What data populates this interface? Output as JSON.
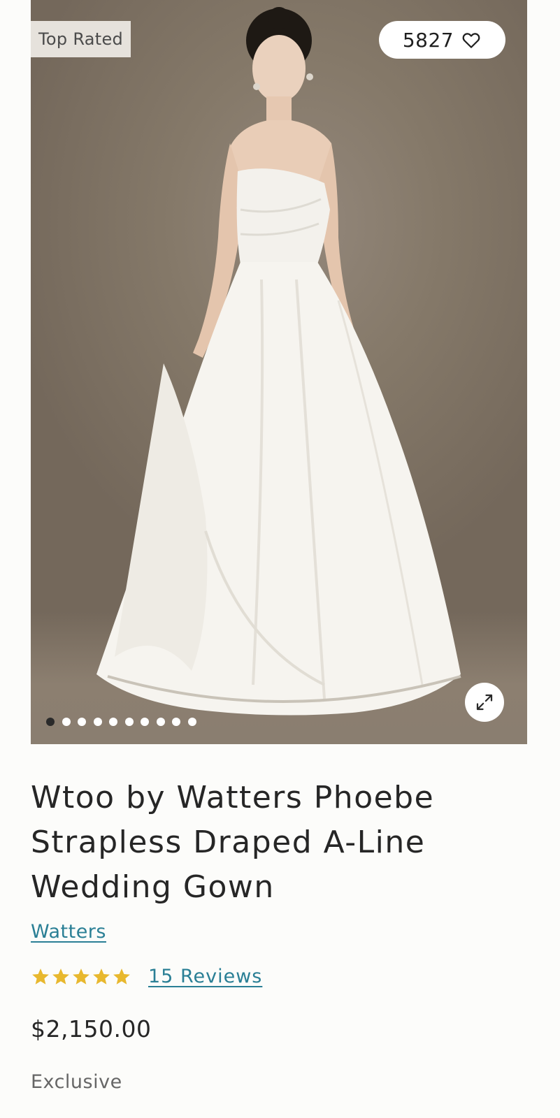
{
  "gallery": {
    "badge": "Top Rated",
    "favorites_count": "5827",
    "image_count": 10,
    "active_image_index": 0
  },
  "product": {
    "title": "Wtoo by Watters Phoebe Strapless Draped A-Line Wedding Gown",
    "brand": "Watters",
    "rating": 5,
    "rating_max": 5,
    "reviews": "15 Reviews",
    "price": "$2,150.00",
    "tag": "Exclusive"
  },
  "colors": {
    "link": "#2a7f95",
    "star": "#e8b82e",
    "text": "#262626",
    "badge_bg": "#e6e2dc"
  },
  "icons": {
    "favorite": "heart-icon",
    "expand": "expand-arrows-icon",
    "rating": "star-icon"
  }
}
